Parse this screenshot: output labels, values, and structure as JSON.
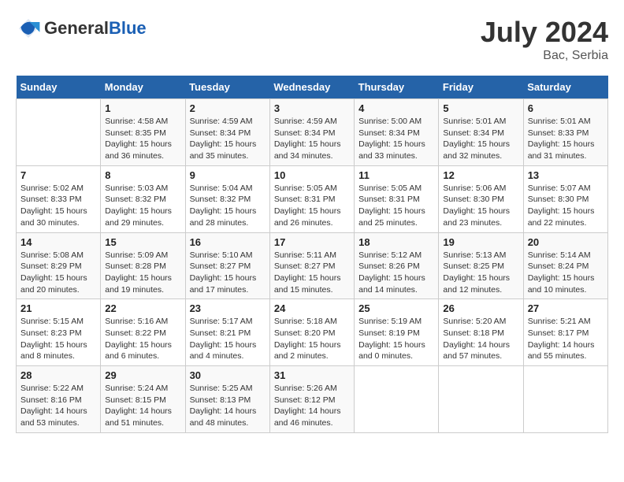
{
  "header": {
    "logo_line1": "General",
    "logo_line2": "Blue",
    "month_year": "July 2024",
    "location": "Bac, Serbia"
  },
  "weekdays": [
    "Sunday",
    "Monday",
    "Tuesday",
    "Wednesday",
    "Thursday",
    "Friday",
    "Saturday"
  ],
  "weeks": [
    [
      {
        "day": "",
        "sunrise": "",
        "sunset": "",
        "daylight": ""
      },
      {
        "day": "1",
        "sunrise": "Sunrise: 4:58 AM",
        "sunset": "Sunset: 8:35 PM",
        "daylight": "Daylight: 15 hours and 36 minutes."
      },
      {
        "day": "2",
        "sunrise": "Sunrise: 4:59 AM",
        "sunset": "Sunset: 8:34 PM",
        "daylight": "Daylight: 15 hours and 35 minutes."
      },
      {
        "day": "3",
        "sunrise": "Sunrise: 4:59 AM",
        "sunset": "Sunset: 8:34 PM",
        "daylight": "Daylight: 15 hours and 34 minutes."
      },
      {
        "day": "4",
        "sunrise": "Sunrise: 5:00 AM",
        "sunset": "Sunset: 8:34 PM",
        "daylight": "Daylight: 15 hours and 33 minutes."
      },
      {
        "day": "5",
        "sunrise": "Sunrise: 5:01 AM",
        "sunset": "Sunset: 8:34 PM",
        "daylight": "Daylight: 15 hours and 32 minutes."
      },
      {
        "day": "6",
        "sunrise": "Sunrise: 5:01 AM",
        "sunset": "Sunset: 8:33 PM",
        "daylight": "Daylight: 15 hours and 31 minutes."
      }
    ],
    [
      {
        "day": "7",
        "sunrise": "Sunrise: 5:02 AM",
        "sunset": "Sunset: 8:33 PM",
        "daylight": "Daylight: 15 hours and 30 minutes."
      },
      {
        "day": "8",
        "sunrise": "Sunrise: 5:03 AM",
        "sunset": "Sunset: 8:32 PM",
        "daylight": "Daylight: 15 hours and 29 minutes."
      },
      {
        "day": "9",
        "sunrise": "Sunrise: 5:04 AM",
        "sunset": "Sunset: 8:32 PM",
        "daylight": "Daylight: 15 hours and 28 minutes."
      },
      {
        "day": "10",
        "sunrise": "Sunrise: 5:05 AM",
        "sunset": "Sunset: 8:31 PM",
        "daylight": "Daylight: 15 hours and 26 minutes."
      },
      {
        "day": "11",
        "sunrise": "Sunrise: 5:05 AM",
        "sunset": "Sunset: 8:31 PM",
        "daylight": "Daylight: 15 hours and 25 minutes."
      },
      {
        "day": "12",
        "sunrise": "Sunrise: 5:06 AM",
        "sunset": "Sunset: 8:30 PM",
        "daylight": "Daylight: 15 hours and 23 minutes."
      },
      {
        "day": "13",
        "sunrise": "Sunrise: 5:07 AM",
        "sunset": "Sunset: 8:30 PM",
        "daylight": "Daylight: 15 hours and 22 minutes."
      }
    ],
    [
      {
        "day": "14",
        "sunrise": "Sunrise: 5:08 AM",
        "sunset": "Sunset: 8:29 PM",
        "daylight": "Daylight: 15 hours and 20 minutes."
      },
      {
        "day": "15",
        "sunrise": "Sunrise: 5:09 AM",
        "sunset": "Sunset: 8:28 PM",
        "daylight": "Daylight: 15 hours and 19 minutes."
      },
      {
        "day": "16",
        "sunrise": "Sunrise: 5:10 AM",
        "sunset": "Sunset: 8:27 PM",
        "daylight": "Daylight: 15 hours and 17 minutes."
      },
      {
        "day": "17",
        "sunrise": "Sunrise: 5:11 AM",
        "sunset": "Sunset: 8:27 PM",
        "daylight": "Daylight: 15 hours and 15 minutes."
      },
      {
        "day": "18",
        "sunrise": "Sunrise: 5:12 AM",
        "sunset": "Sunset: 8:26 PM",
        "daylight": "Daylight: 15 hours and 14 minutes."
      },
      {
        "day": "19",
        "sunrise": "Sunrise: 5:13 AM",
        "sunset": "Sunset: 8:25 PM",
        "daylight": "Daylight: 15 hours and 12 minutes."
      },
      {
        "day": "20",
        "sunrise": "Sunrise: 5:14 AM",
        "sunset": "Sunset: 8:24 PM",
        "daylight": "Daylight: 15 hours and 10 minutes."
      }
    ],
    [
      {
        "day": "21",
        "sunrise": "Sunrise: 5:15 AM",
        "sunset": "Sunset: 8:23 PM",
        "daylight": "Daylight: 15 hours and 8 minutes."
      },
      {
        "day": "22",
        "sunrise": "Sunrise: 5:16 AM",
        "sunset": "Sunset: 8:22 PM",
        "daylight": "Daylight: 15 hours and 6 minutes."
      },
      {
        "day": "23",
        "sunrise": "Sunrise: 5:17 AM",
        "sunset": "Sunset: 8:21 PM",
        "daylight": "Daylight: 15 hours and 4 minutes."
      },
      {
        "day": "24",
        "sunrise": "Sunrise: 5:18 AM",
        "sunset": "Sunset: 8:20 PM",
        "daylight": "Daylight: 15 hours and 2 minutes."
      },
      {
        "day": "25",
        "sunrise": "Sunrise: 5:19 AM",
        "sunset": "Sunset: 8:19 PM",
        "daylight": "Daylight: 15 hours and 0 minutes."
      },
      {
        "day": "26",
        "sunrise": "Sunrise: 5:20 AM",
        "sunset": "Sunset: 8:18 PM",
        "daylight": "Daylight: 14 hours and 57 minutes."
      },
      {
        "day": "27",
        "sunrise": "Sunrise: 5:21 AM",
        "sunset": "Sunset: 8:17 PM",
        "daylight": "Daylight: 14 hours and 55 minutes."
      }
    ],
    [
      {
        "day": "28",
        "sunrise": "Sunrise: 5:22 AM",
        "sunset": "Sunset: 8:16 PM",
        "daylight": "Daylight: 14 hours and 53 minutes."
      },
      {
        "day": "29",
        "sunrise": "Sunrise: 5:24 AM",
        "sunset": "Sunset: 8:15 PM",
        "daylight": "Daylight: 14 hours and 51 minutes."
      },
      {
        "day": "30",
        "sunrise": "Sunrise: 5:25 AM",
        "sunset": "Sunset: 8:13 PM",
        "daylight": "Daylight: 14 hours and 48 minutes."
      },
      {
        "day": "31",
        "sunrise": "Sunrise: 5:26 AM",
        "sunset": "Sunset: 8:12 PM",
        "daylight": "Daylight: 14 hours and 46 minutes."
      },
      {
        "day": "",
        "sunrise": "",
        "sunset": "",
        "daylight": ""
      },
      {
        "day": "",
        "sunrise": "",
        "sunset": "",
        "daylight": ""
      },
      {
        "day": "",
        "sunrise": "",
        "sunset": "",
        "daylight": ""
      }
    ]
  ]
}
